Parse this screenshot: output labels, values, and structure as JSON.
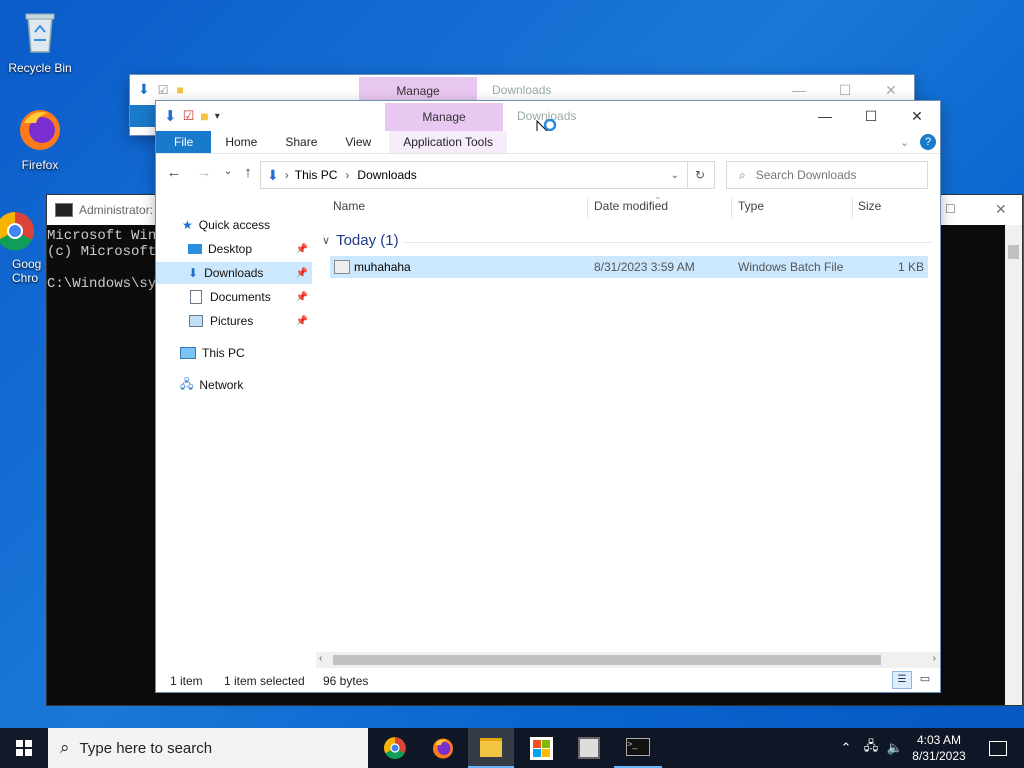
{
  "desktop": {
    "icons": [
      {
        "label": "Recycle Bin"
      },
      {
        "label": "Firefox"
      },
      {
        "label": "Goog Chro"
      }
    ]
  },
  "back_explorer": {
    "manage_label": "Manage",
    "title": "Downloads"
  },
  "cmd": {
    "title": "Administrator:",
    "lines": [
      "Microsoft Wind",
      "(c) Microsoft",
      "",
      "C:\\Windows\\sys"
    ]
  },
  "explorer": {
    "manage_label": "Manage",
    "title": "Downloads",
    "tabs": [
      "File",
      "Home",
      "Share",
      "View",
      "Application Tools"
    ],
    "breadcrumb": [
      "This PC",
      "Downloads"
    ],
    "search_placeholder": "Search Downloads",
    "nav": {
      "quick_access": "Quick access",
      "desktop": "Desktop",
      "downloads": "Downloads",
      "documents": "Documents",
      "pictures": "Pictures",
      "this_pc": "This PC",
      "network": "Network"
    },
    "columns": {
      "name": "Name",
      "date": "Date modified",
      "type": "Type",
      "size": "Size"
    },
    "group": "Today (1)",
    "files": [
      {
        "name": "muhahaha",
        "date": "8/31/2023 3:59 AM",
        "type": "Windows Batch File",
        "size": "1 KB"
      }
    ],
    "status": {
      "count": "1 item",
      "selected": "1 item selected",
      "bytes": "96 bytes"
    }
  },
  "taskbar": {
    "search_placeholder": "Type here to search",
    "time": "4:03 AM",
    "date": "8/31/2023"
  }
}
